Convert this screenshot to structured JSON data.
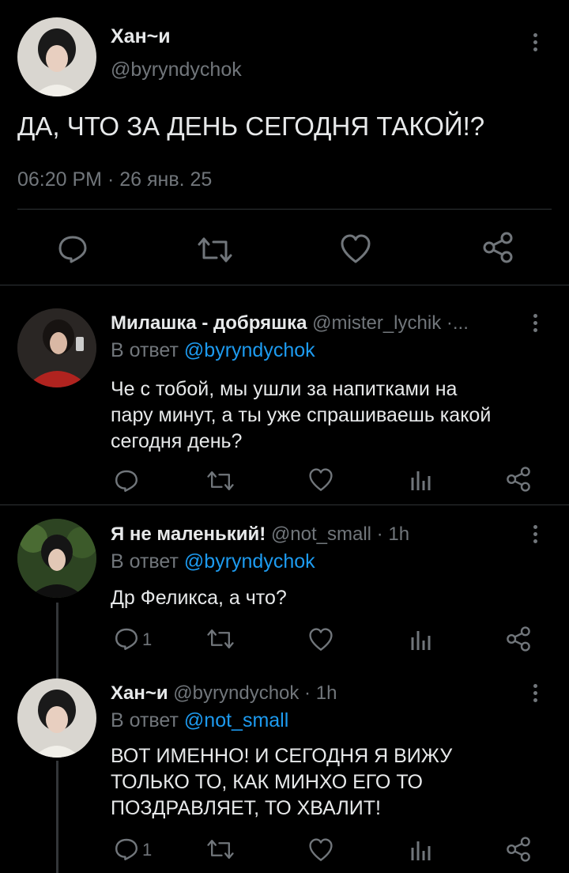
{
  "main_tweet": {
    "author_name": "Хан~и",
    "handle": "@byryndychok",
    "text": "ДА, ЧТО ЗА ДЕНЬ СЕГОДНЯ ТАКОЙ!?",
    "time": "06:20 PM",
    "date": "26 янв. 25"
  },
  "replies": [
    {
      "author_name": "Милашка - добряшка",
      "handle": "@mister_lychik",
      "meta_suffix": " ·...",
      "reply_prefix": "В ответ",
      "reply_to": "@byryndychok",
      "text_lines": [
        "Че с тобой, мы ушли за напитками на",
        "пару минут, а ты уже спрашиваешь какой",
        "сегодня день?"
      ],
      "reply_count": ""
    },
    {
      "author_name": "Я не маленький!",
      "handle": "@not_small",
      "meta_suffix": " · 1h",
      "reply_prefix": "В ответ",
      "reply_to": "@byryndychok",
      "text_lines": [
        "Др Феликса, а что?"
      ],
      "reply_count": "1"
    },
    {
      "author_name": "Хан~и",
      "handle": "@byryndychok",
      "meta_suffix": " · 1h",
      "reply_prefix": "В ответ",
      "reply_to": "@not_small",
      "text_lines": [
        "ВОТ ИМЕННО! И СЕГОДНЯ Я ВИЖУ",
        "ТОЛЬКО ТО, КАК МИНХО ЕГО ТО",
        "ПОЗДРАВЛЯЕТ, ТО ХВАЛИТ!"
      ],
      "reply_count": "1"
    }
  ],
  "colors": {
    "background": "#000000",
    "text": "#e7e9ea",
    "muted": "#71767b",
    "link": "#1d9bf0",
    "divider": "#2f3336"
  },
  "icons": [
    "comment-icon",
    "retweet-icon",
    "heart-icon",
    "share-icon",
    "analytics-icon",
    "more-icon"
  ]
}
